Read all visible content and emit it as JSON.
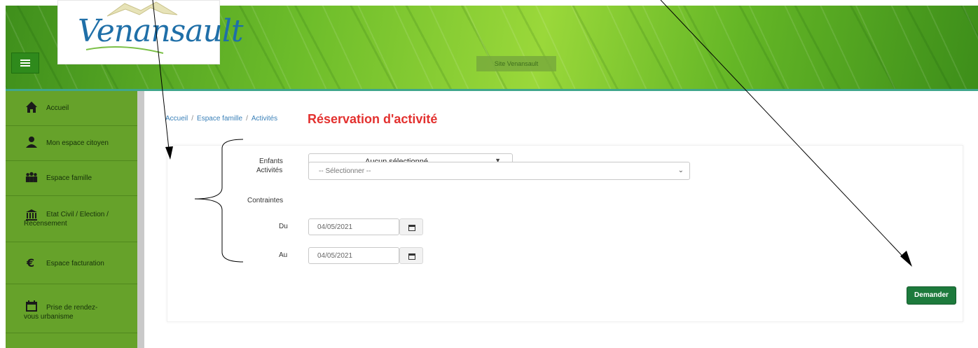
{
  "header": {
    "logo_text": "Venansault",
    "site_badge": "Site Venansault"
  },
  "sidebar": {
    "items": [
      {
        "label": "Accueil",
        "icon": "home-icon"
      },
      {
        "label": "Mon espace citoyen",
        "icon": "user-icon"
      },
      {
        "label": "Espace famille",
        "icon": "family-icon"
      },
      {
        "label": "Etat Civil / Election / Recensement",
        "icon": "town-hall-icon"
      },
      {
        "label": "Espace facturation",
        "icon": "euro-icon"
      },
      {
        "label": "Prise de rendez-vous urbanisme",
        "icon": "calendar-icon"
      }
    ]
  },
  "breadcrumb": {
    "items": [
      "Accueil",
      "Espace famille",
      "Activités"
    ],
    "separator": "/"
  },
  "main": {
    "title": "Réservation d'activité"
  },
  "form": {
    "enfants_label": "Enfants",
    "enfants_value": "Aucun sélectionné",
    "activites_label": "Activités",
    "activites_value": "-- Sélectionner --",
    "contraintes_label": "Contraintes",
    "du_label": "Du",
    "du_value": "04/05/2021",
    "au_label": "Au",
    "au_value": "04/05/2021",
    "submit_label": "Demander"
  },
  "colors": {
    "sidebar_bg": "#66a22a",
    "title_red": "#e3312f",
    "button_green": "#1d7a3c",
    "link_blue": "#3a80b8"
  }
}
